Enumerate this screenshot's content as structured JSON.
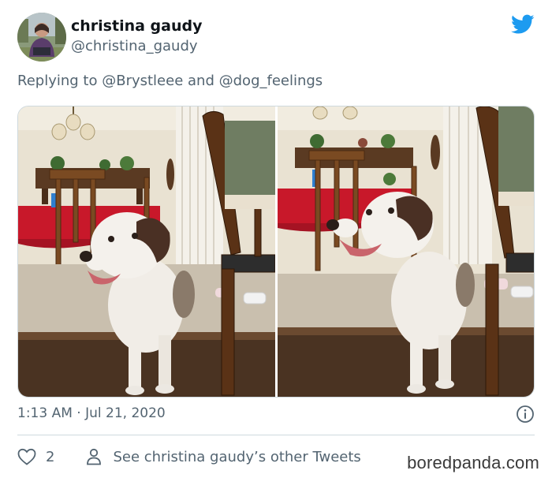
{
  "user": {
    "name": "christina gaudy",
    "handle": "@christina_gaudy",
    "avatar_icon": "user-avatar-photo"
  },
  "brand_icon": "twitter-bird-icon",
  "reply": {
    "prefix": "Replying to",
    "mention1": "@Brystleee",
    "conjunction": "and",
    "mention2": "@dog_feelings"
  },
  "media": {
    "count": 2,
    "subject": "white and brown dog sitting beside wooden chair"
  },
  "meta": {
    "timestamp": "1:13 AM · Jul 21, 2020",
    "info_icon": "info-icon"
  },
  "actions": {
    "like_icon": "heart-icon",
    "like_count": "2",
    "profile_icon": "person-icon",
    "profile_link": "See christina gaudy’s other Tweets"
  },
  "watermark": "boredpanda.com",
  "colors": {
    "brand": "#1d9bf0",
    "secondary_text": "#536471",
    "primary_text": "#0f1419",
    "border": "#cfd9de"
  }
}
